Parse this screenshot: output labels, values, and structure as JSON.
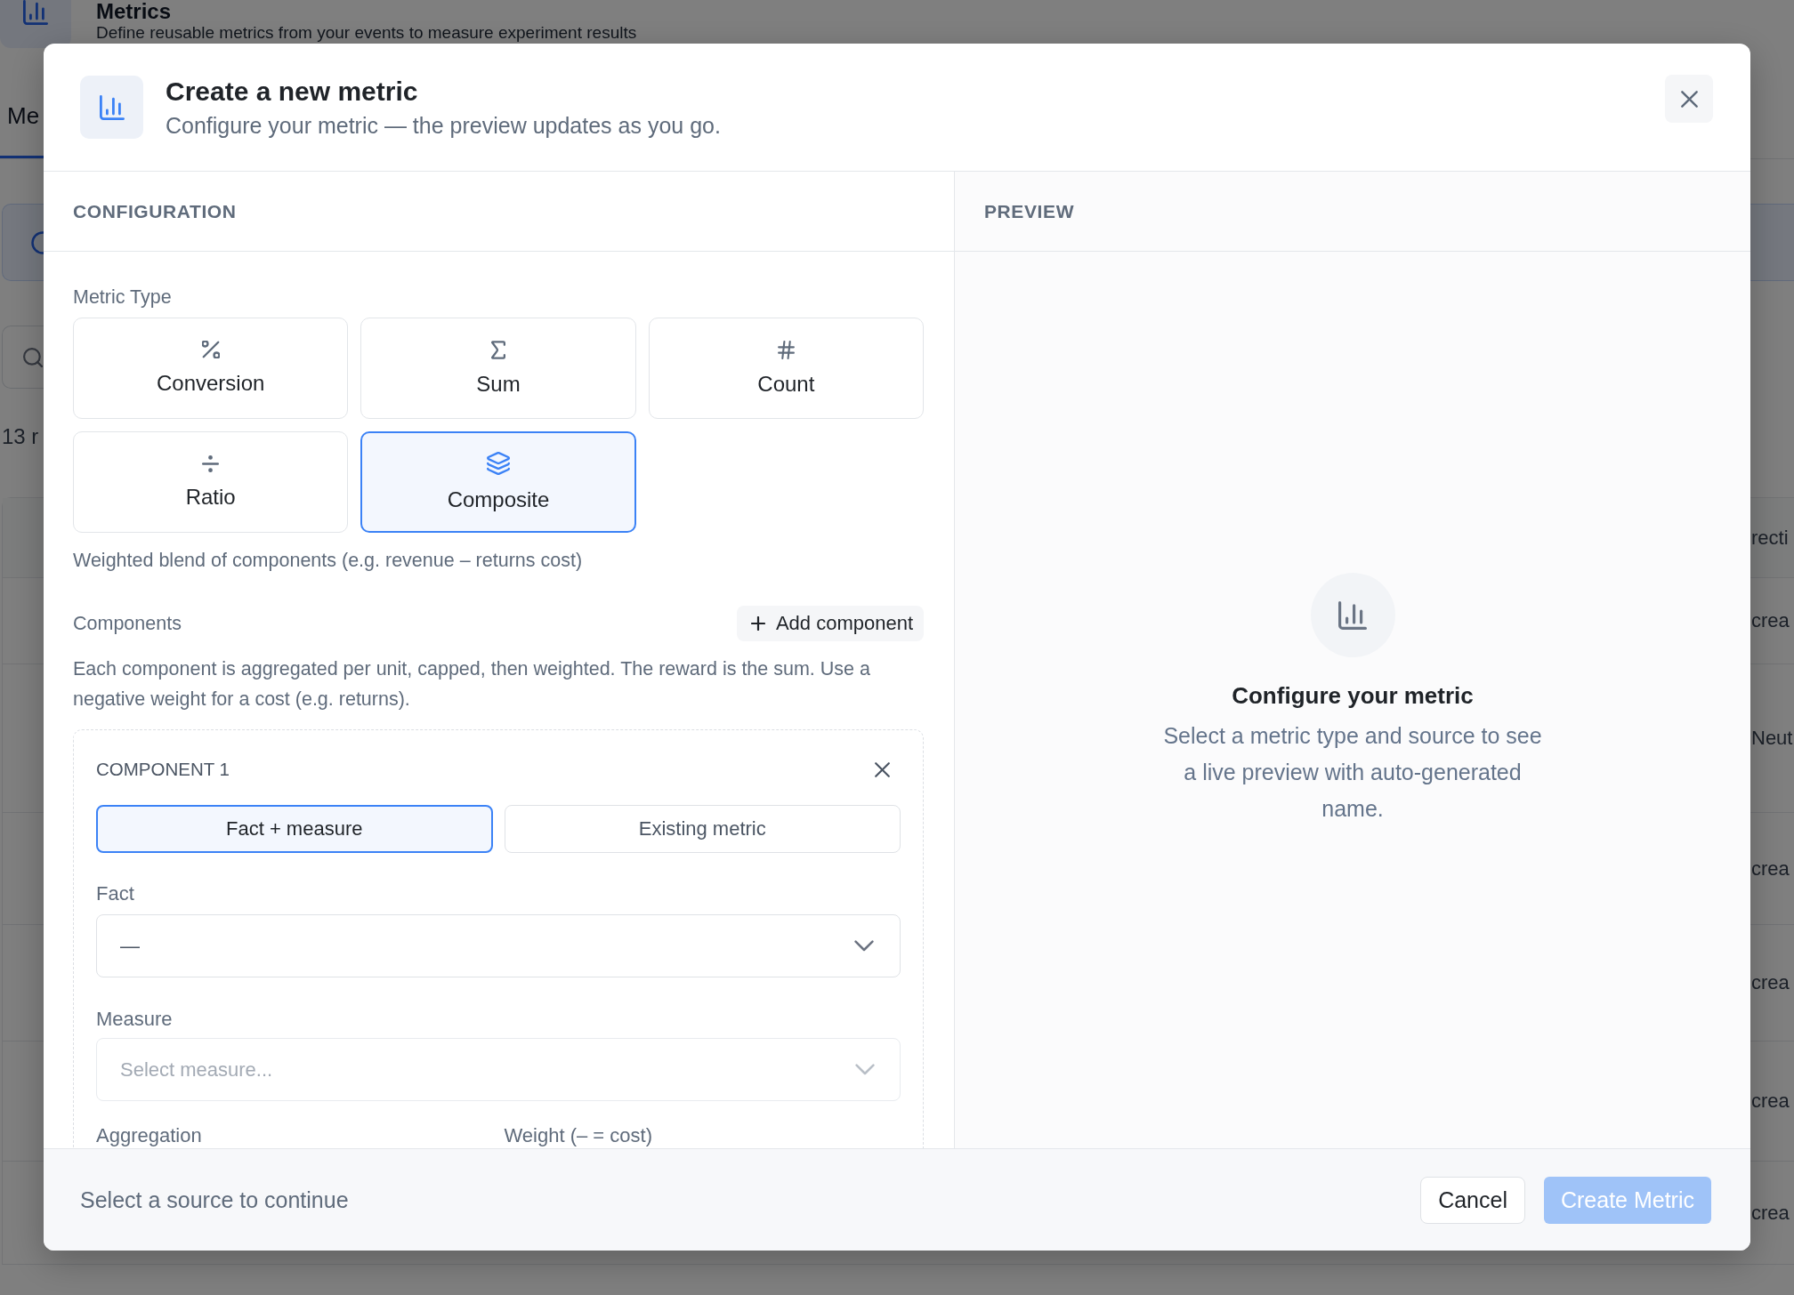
{
  "page": {
    "title": "Metrics",
    "subtitle": "Define reusable metrics from your events to measure experiment results",
    "tabs": [
      {
        "label": "Me",
        "selected": true
      }
    ],
    "count": "13 r",
    "table": {
      "column_header": "recti",
      "cells": [
        "crea",
        "Neut",
        "crea",
        "crea",
        "crea",
        "crea"
      ]
    }
  },
  "dialog": {
    "title": "Create a new metric",
    "subtitle": "Configure your metric — the preview updates as you go."
  },
  "configuration": {
    "heading": "CONFIGURATION",
    "metric_type_label": "Metric Type",
    "metric_types": [
      {
        "kind": "conversion",
        "label": "Conversion",
        "selected": false
      },
      {
        "kind": "sum",
        "label": "Sum",
        "selected": false
      },
      {
        "kind": "count",
        "label": "Count",
        "selected": false
      },
      {
        "kind": "ratio",
        "label": "Ratio",
        "selected": false
      },
      {
        "kind": "composite",
        "label": "Composite",
        "selected": true
      }
    ],
    "type_description": "Weighted blend of components (e.g. revenue – returns cost)",
    "components_label": "Components",
    "add_button": "Add component",
    "help": "Each component is aggregated per unit, capped, then weighted. The reward is the sum. Use a negative weight for a cost (e.g. returns).",
    "components": [
      {
        "title": "COMPONENT 1",
        "sources": [
          {
            "label": "Fact + measure",
            "selected": true
          },
          {
            "label": "Existing metric",
            "selected": false
          }
        ],
        "fact": {
          "label": "Fact",
          "value": "—"
        },
        "measure": {
          "label": "Measure",
          "placeholder": "Select measure...",
          "disabled": true
        },
        "aggregation_label": "Aggregation",
        "weight_label": "Weight (– = cost)"
      }
    ]
  },
  "preview": {
    "heading": "PREVIEW",
    "empty_title": "Configure your metric",
    "empty_text": "Select a metric type and source to see a live preview with auto-generated name."
  },
  "footer": {
    "status": "Select a source to continue",
    "cancel": "Cancel",
    "create": {
      "label": "Create Metric",
      "disabled": true
    }
  }
}
